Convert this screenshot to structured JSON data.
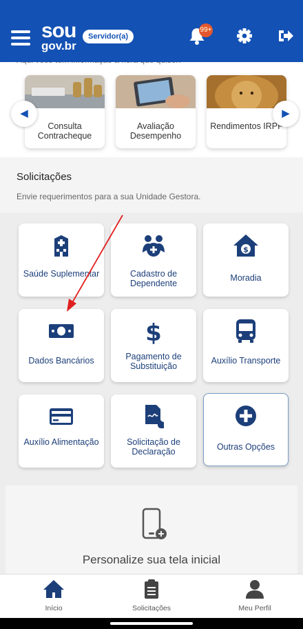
{
  "header": {
    "logo_top": "sou",
    "logo_bottom": "gov.br",
    "badge": "Servidor(a)",
    "notification_count": "99+"
  },
  "intro_text": "Aqui você tem informação a hora que quiser!",
  "carousel": {
    "cards": [
      {
        "label": "Consulta Contracheque"
      },
      {
        "label": "Avaliação Desempenho"
      },
      {
        "label": "Rendimentos IRPF"
      }
    ]
  },
  "requests": {
    "title": "Solicitações",
    "subtitle": "Envie requerimentos para a sua Unidade Gestora."
  },
  "services": [
    {
      "label": "Saúde Suplementar",
      "icon": "hospital-icon"
    },
    {
      "label": "Cadastro de Dependente",
      "icon": "dependents-icon"
    },
    {
      "label": "Moradia",
      "icon": "house-money-icon"
    },
    {
      "label": "Dados Bancários",
      "icon": "banknote-icon"
    },
    {
      "label": "Pagamento de Substituição",
      "icon": "dollar-icon"
    },
    {
      "label": "Auxílio Transporte",
      "icon": "bus-icon"
    },
    {
      "label": "Auxílio Alimentação",
      "icon": "card-icon"
    },
    {
      "label": "Solicitação de Declaração",
      "icon": "document-sign-icon"
    },
    {
      "label": "Outras Opções",
      "icon": "plus-circle-icon"
    }
  ],
  "personalize": {
    "title": "Personalize sua tela inicial"
  },
  "bottom_nav": [
    {
      "label": "Início",
      "icon": "home-icon"
    },
    {
      "label": "Solicitações",
      "icon": "clipboard-icon"
    },
    {
      "label": "Meu Perfil",
      "icon": "user-icon"
    }
  ],
  "colors": {
    "primary": "#1351b4",
    "dark_icon": "#1c3f7a",
    "annotation": "#e02020"
  }
}
